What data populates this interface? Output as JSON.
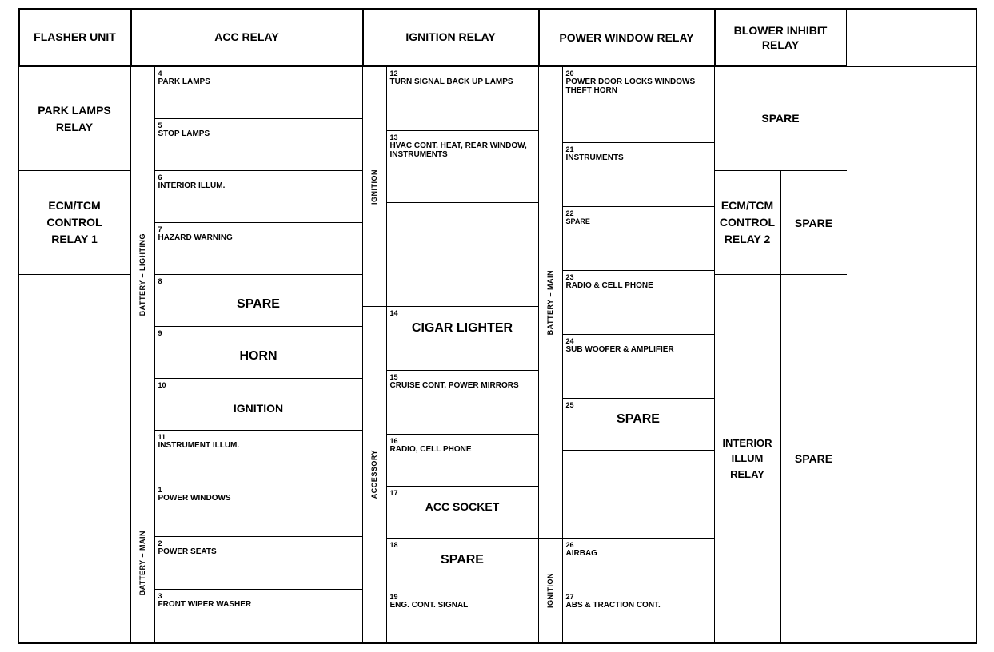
{
  "header": {
    "col1": "FLASHER UNIT",
    "col2": "ACC RELAY",
    "col3": "IGNITION RELAY",
    "col4": "POWER WINDOW RELAY",
    "col5": "BLOWER INHIBIT RELAY"
  },
  "col1": {
    "park_lamps": "PARK\nLAMPS\nRELAY",
    "ecm_tcm": "ECM/TCM\nCONTROL\nRELAY 1"
  },
  "battery_lighting_label": "BATTERY – LIGHTING",
  "battery_main_label": "BATTERY – MAIN",
  "ignition_label": "IGNITION",
  "accessory_label": "ACCESSORY",
  "battery_main2_label": "BATTERY – MAIN",
  "ignition2_label": "IGNITION",
  "fuses": {
    "f4": {
      "num": "4",
      "label": "PARK LAMPS"
    },
    "f5": {
      "num": "5",
      "label": "STOP LAMPS"
    },
    "f6": {
      "num": "6",
      "label": "INTERIOR ILLUM."
    },
    "f7": {
      "num": "7",
      "label": "HAZARD WARNING"
    },
    "f8": {
      "num": "8",
      "label": "SPARE"
    },
    "f9": {
      "num": "9",
      "label": "HORN"
    },
    "f10": {
      "num": "10",
      "label": "IGNITION"
    },
    "f11": {
      "num": "11",
      "label": "INSTRUMENT ILLUM."
    },
    "f1": {
      "num": "1",
      "label": "POWER WINDOWS"
    },
    "f2": {
      "num": "2",
      "label": "POWER SEATS"
    },
    "f3": {
      "num": "3",
      "label": "FRONT WIPER WASHER"
    },
    "f12": {
      "num": "12",
      "label": "TURN SIGNAL BACK UP LAMPS"
    },
    "f13": {
      "num": "13",
      "label": "HVAC CONT. HEAT, REAR WINDOW, INSTRUMENTS"
    },
    "f14": {
      "num": "14",
      "label": "CIGAR LIGHTER"
    },
    "f15": {
      "num": "15",
      "label": "CRUISE CONT. POWER MIRRORS"
    },
    "f16": {
      "num": "16",
      "label": "RADIO, CELL PHONE"
    },
    "f17": {
      "num": "17",
      "label": "ACC SOCKET"
    },
    "f18": {
      "num": "18",
      "label": "SPARE"
    },
    "f19": {
      "num": "19",
      "label": "ENG. CONT. SIGNAL"
    },
    "f20": {
      "num": "20",
      "label": "POWER DOOR LOCKS WINDOWS THEFT HORN"
    },
    "f21": {
      "num": "21",
      "label": "INSTRUMENTS"
    },
    "f22": {
      "num": "22",
      "label": "SPARE"
    },
    "f23": {
      "num": "23",
      "label": "RADIO & CELL PHONE"
    },
    "f24": {
      "num": "24",
      "label": "SUB WOOFER & AMPLIFIER"
    },
    "f25": {
      "num": "25",
      "label": "SPARE"
    },
    "f26": {
      "num": "26",
      "label": "AIRBAG"
    },
    "f27": {
      "num": "27",
      "label": "ABS & TRACTION CONT."
    },
    "spare1": "SPARE",
    "ecm_tcm2": "ECM/TCM\nCONTROL\nRELAY 2",
    "spare2": "SPARE",
    "interior_illum_relay": "INTERIOR\nILLUM\nRELAY"
  }
}
